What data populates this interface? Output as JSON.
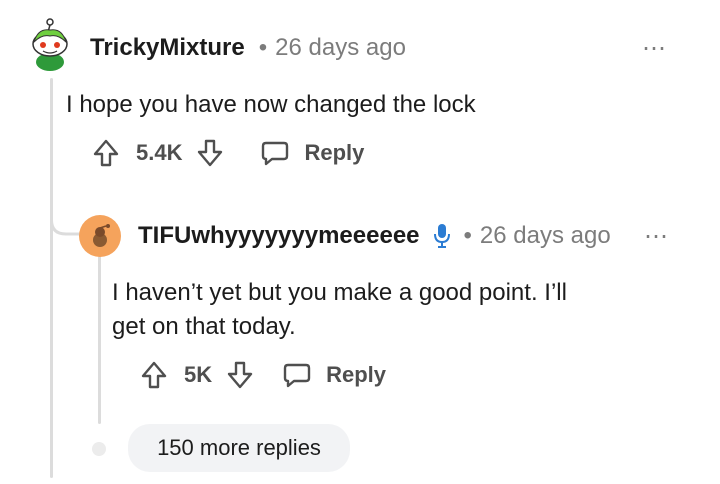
{
  "comment": {
    "username": "TrickyMixture",
    "time": "26 days ago",
    "body": "I hope you have now changed the lock",
    "upvotes": "5.4K",
    "reply_label": "Reply",
    "more_label": "⋯"
  },
  "reply": {
    "username": "TIFUwhyyyyyyymeeeeee",
    "time": "26 days ago",
    "body_line1": "I haven’t yet but you make a good point. I’ll",
    "body_line2": "get on that today.",
    "upvotes": "5K",
    "reply_label": "Reply",
    "more_label": "⋯"
  },
  "more_replies_label": "150 more replies",
  "colors": {
    "mic_icon": "#2b7cd3",
    "avatar_orange": "#f5a35c"
  }
}
